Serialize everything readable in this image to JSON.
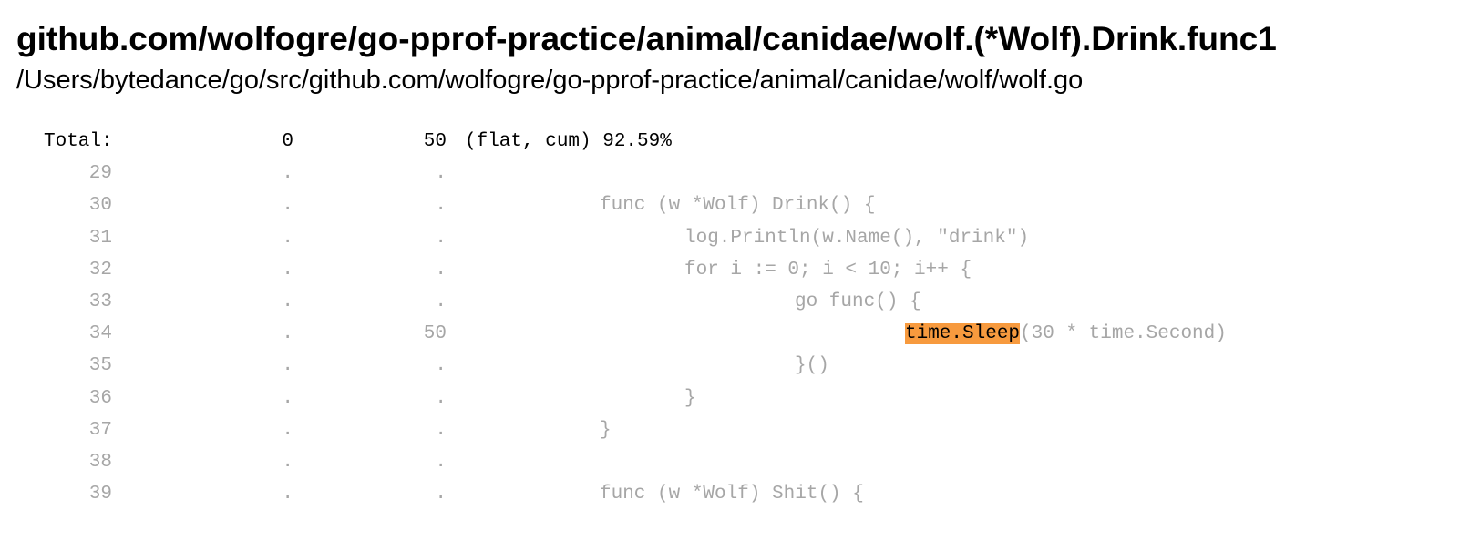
{
  "header": {
    "function_name": "github.com/wolfogre/go-pprof-practice/animal/canidae/wolf.(*Wolf).Drink.func1",
    "file_path": "/Users/bytedance/go/src/github.com/wolfogre/go-pprof-practice/animal/canidae/wolf/wolf.go"
  },
  "total": {
    "label": "Total:",
    "flat": "0",
    "cum": "50",
    "summary": "(flat, cum) 92.59%"
  },
  "colors": {
    "highlight": "#f79a3e",
    "dim_text": "#a6a6a6",
    "text": "#000000"
  },
  "lines": [
    {
      "no": "29",
      "flat": ".",
      "cum": ".",
      "indent": 0,
      "code": ""
    },
    {
      "no": "30",
      "flat": ".",
      "cum": ".",
      "indent": 0,
      "code": "func (w *Wolf) Drink() {"
    },
    {
      "no": "31",
      "flat": ".",
      "cum": ".",
      "indent": 1,
      "code": "log.Println(w.Name(), \"drink\")"
    },
    {
      "no": "32",
      "flat": ".",
      "cum": ".",
      "indent": 1,
      "code": "for i := 0; i < 10; i++ {"
    },
    {
      "no": "33",
      "flat": ".",
      "cum": ".",
      "indent": 2,
      "code": "go func() {"
    },
    {
      "no": "34",
      "flat": ".",
      "cum": "50",
      "indent": 3,
      "highlight": "time.Sleep",
      "code": "(30 * time.Second)"
    },
    {
      "no": "35",
      "flat": ".",
      "cum": ".",
      "indent": 2,
      "code": "}()"
    },
    {
      "no": "36",
      "flat": ".",
      "cum": ".",
      "indent": 1,
      "code": "}"
    },
    {
      "no": "37",
      "flat": ".",
      "cum": ".",
      "indent": 0,
      "code": "}"
    },
    {
      "no": "38",
      "flat": ".",
      "cum": ".",
      "indent": 0,
      "code": ""
    },
    {
      "no": "39",
      "flat": ".",
      "cum": ".",
      "indent": 0,
      "code": "func (w *Wolf) Shit() {"
    }
  ]
}
